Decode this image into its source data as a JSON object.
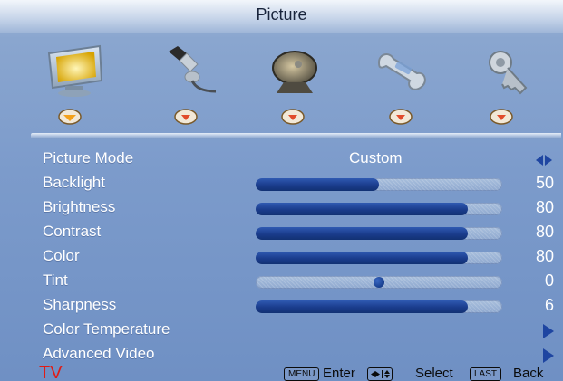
{
  "window": {
    "title": "Picture"
  },
  "icons": [
    {
      "name": "picture-tab",
      "icon": "monitor-icon"
    },
    {
      "name": "audio-tab",
      "icon": "microphone-icon"
    },
    {
      "name": "channels-tab",
      "icon": "satellite-dish-icon"
    },
    {
      "name": "setup-tab",
      "icon": "wrench-icon"
    },
    {
      "name": "lock-tab",
      "icon": "key-icon"
    }
  ],
  "menu": {
    "picture_mode": {
      "label": "Picture Mode",
      "value": "Custom"
    },
    "backlight": {
      "label": "Backlight",
      "value": "50",
      "level": 0.5
    },
    "brightness": {
      "label": "Brightness",
      "value": "80",
      "level": 0.86
    },
    "contrast": {
      "label": "Contrast",
      "value": "80",
      "level": 0.86
    },
    "color": {
      "label": "Color",
      "value": "80",
      "level": 0.86
    },
    "tint": {
      "label": "Tint",
      "value": "0",
      "level": 0.5
    },
    "sharpness": {
      "label": "Sharpness",
      "value": "6",
      "level": 0.86
    },
    "color_temperature": {
      "label": "Color Temperature"
    },
    "advanced_video": {
      "label": "Advanced Video"
    }
  },
  "footer": {
    "source": "TV",
    "menu_key": "MENU",
    "enter": "Enter",
    "select": "Select",
    "last_key": "LAST",
    "back": "Back"
  },
  "colors": {
    "accent_blue": "#1e45a1",
    "fill_blue": "#1a3c8c",
    "tv_red": "#e11b14",
    "background": "#7c9bcb"
  }
}
